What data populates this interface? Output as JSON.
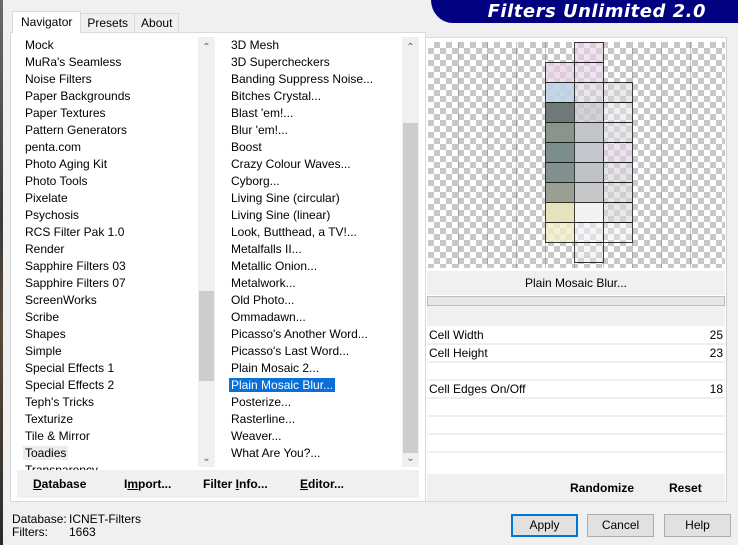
{
  "window": {
    "banner_title": "Filters Unlimited 2.0"
  },
  "tabs": [
    {
      "label": "Navigator",
      "active": true
    },
    {
      "label": "Presets",
      "active": false
    },
    {
      "label": "About",
      "active": false
    }
  ],
  "categories": {
    "items": [
      "Mock",
      "MuRa's Seamless",
      "Noise Filters",
      "Paper Backgrounds",
      "Paper Textures",
      "Pattern Generators",
      "penta.com",
      "Photo Aging Kit",
      "Photo Tools",
      "Pixelate",
      "Psychosis",
      "RCS Filter Pak 1.0",
      "Render",
      "Sapphire Filters 03",
      "Sapphire Filters 07",
      "ScreenWorks",
      "Scribe",
      "Shapes",
      "Simple",
      "Special Effects 1",
      "Special Effects 2",
      "Teph's Tricks",
      "Texturize",
      "Tile & Mirror",
      "Toadies",
      "Transparency"
    ],
    "focused": "Toadies"
  },
  "filters": {
    "items": [
      "3D Mesh",
      "3D Supercheckers",
      "Banding Suppress Noise...",
      "Bitches Crystal...",
      "Blast 'em!...",
      "Blur 'em!...",
      "Boost",
      "Crazy Colour Waves...",
      "Cyborg...",
      "Living Sine (circular)",
      "Living Sine (linear)",
      "Look, Butthead, a TV!...",
      "Metalfalls II...",
      "Metallic Onion...",
      "Metalwork...",
      "Old Photo...",
      "Ommadawn...",
      "Picasso's Another Word...",
      "Picasso's Last Word...",
      "Plain Mosaic 2...",
      "Plain Mosaic Blur...",
      "Posterize...",
      "Rasterline...",
      "Weaver...",
      "What Are You?..."
    ],
    "selected": "Plain Mosaic Blur..."
  },
  "panel_buttons": {
    "database": {
      "pre": "",
      "u": "D",
      "post": "atabase"
    },
    "import": {
      "pre": "I",
      "u": "m",
      "post": "port..."
    },
    "filter_info": {
      "pre": "Filter ",
      "u": "I",
      "post": "nfo..."
    },
    "editor": {
      "pre": "",
      "u": "E",
      "post": "ditor..."
    }
  },
  "preview": {
    "filter_name": "Plain Mosaic Blur...",
    "progress": 0
  },
  "parameters": [
    {
      "label": "Cell Width",
      "value": "25"
    },
    {
      "label": "Cell Height",
      "value": "23"
    },
    {
      "label": "",
      "value": ""
    },
    {
      "label": "Cell Edges On/Off",
      "value": "18"
    },
    {
      "label": "",
      "value": ""
    },
    {
      "label": "",
      "value": ""
    },
    {
      "label": "",
      "value": ""
    }
  ],
  "right_buttons": {
    "randomize": "Randomize",
    "reset": "Reset"
  },
  "footer": {
    "database_label": "Database:",
    "database_value": "ICNET-Filters",
    "filters_label": "Filters:",
    "filters_value": "1663"
  },
  "dialog_buttons": {
    "apply": "Apply",
    "cancel": "Cancel",
    "help": "Help"
  }
}
